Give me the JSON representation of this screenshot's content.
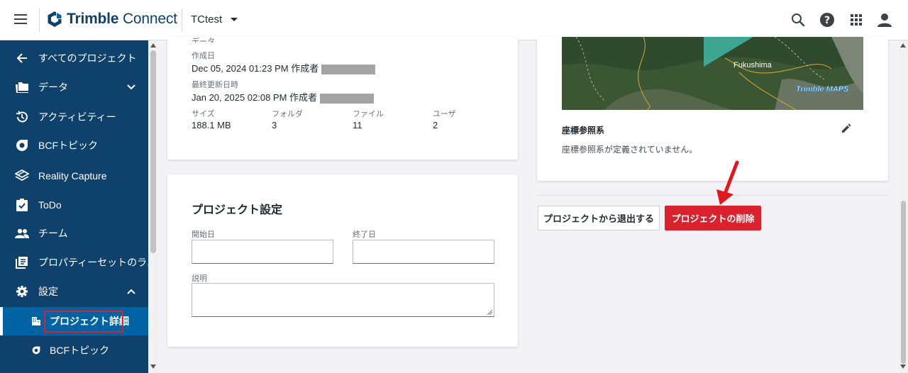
{
  "app": {
    "title_regular": "Trimble",
    "title_light": "Connect"
  },
  "header": {
    "project_name": "TCtest"
  },
  "sidebar": {
    "items": [
      {
        "label": "すべてのプロジェクト"
      },
      {
        "label": "データ"
      },
      {
        "label": "アクティビティー"
      },
      {
        "label": "BCFトピック"
      },
      {
        "label": "Reality Capture"
      },
      {
        "label": "ToDo"
      },
      {
        "label": "チーム"
      },
      {
        "label": "プロパティーセットのラ..."
      },
      {
        "label": "設定"
      },
      {
        "label": "プロジェクト詳細"
      },
      {
        "label": "BCFトピック"
      }
    ]
  },
  "details": {
    "cut_text": "データ",
    "created_label": "作成日",
    "created_value": "Dec 05, 2024 01:23 PM 作成者",
    "updated_label": "最終更新日時",
    "updated_value": "Jan 20, 2025 02:08 PM 作成者",
    "stats": [
      {
        "label": "サイズ",
        "value": "188.1 MB"
      },
      {
        "label": "フォルダ",
        "value": "3"
      },
      {
        "label": "ファイル",
        "value": "11"
      },
      {
        "label": "ユーザ",
        "value": "2"
      }
    ]
  },
  "settings": {
    "title": "プロジェクト設定",
    "start_label": "開始日",
    "end_label": "終了日",
    "desc_label": "説明"
  },
  "location": {
    "map_city": "Fukushima",
    "map_brand": "Trimble MAPS",
    "crs_title": "座標参照系",
    "crs_value": "座標参照系が定義されていません。"
  },
  "actions": {
    "leave_label": "プロジェクトから退出する",
    "delete_label": "プロジェクトの削除"
  },
  "colors": {
    "sidebar": "#0e416c",
    "active": "#0063a3",
    "danger": "#da212c",
    "brand": "#0e416c"
  }
}
